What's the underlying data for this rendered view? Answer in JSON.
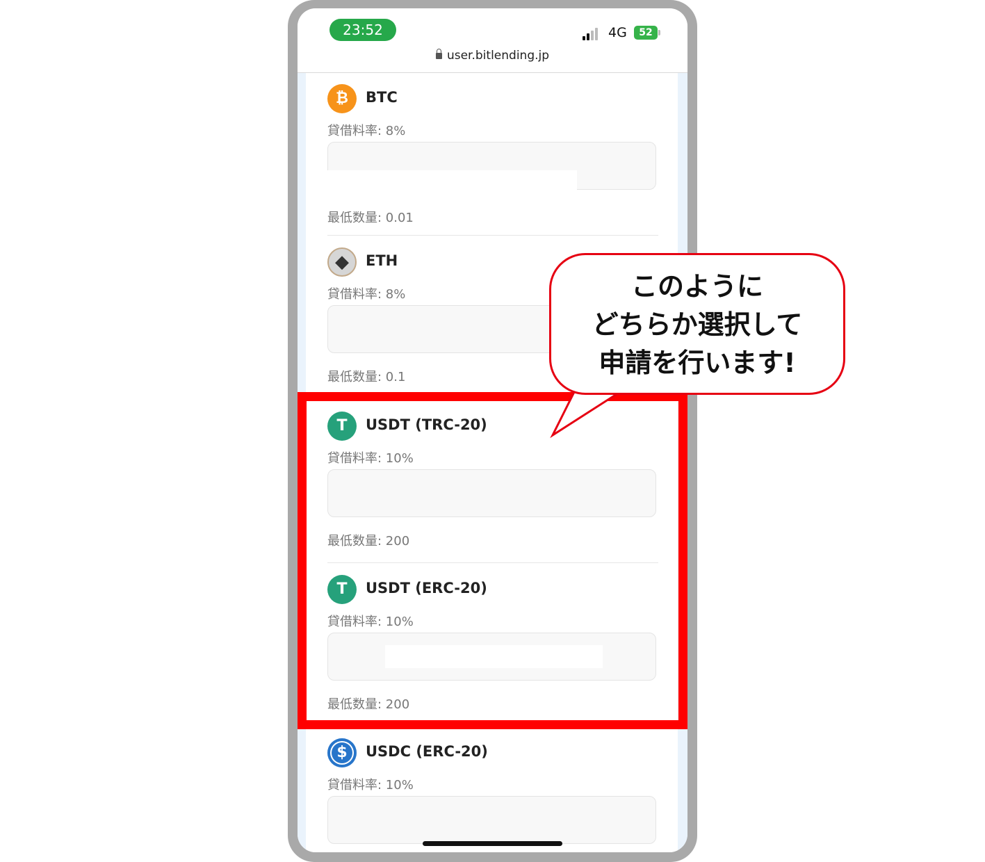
{
  "status_bar": {
    "time": "23:52",
    "network": "4G",
    "battery": "52"
  },
  "browser": {
    "url": "user.bitlending.jp"
  },
  "assets": [
    {
      "name": "BTC",
      "rate": "貸借料率: 8%",
      "min": "最低数量: 0.01",
      "icon": "bitcoin-icon",
      "symbol": "₿"
    },
    {
      "name": "ETH",
      "rate": "貸借料率: 8%",
      "min": "最低数量: 0.1",
      "icon": "ethereum-icon",
      "symbol": "◆"
    },
    {
      "name": "USDT (TRC-20)",
      "rate": "貸借料率: 10%",
      "min": "最低数量: 200",
      "icon": "tether-icon",
      "symbol": "T"
    },
    {
      "name": "USDT (ERC-20)",
      "rate": "貸借料率: 10%",
      "min": "最低数量: 200",
      "icon": "tether-icon",
      "symbol": "T"
    },
    {
      "name": "USDC (ERC-20)",
      "rate": "貸借料率: 10%",
      "icon": "usdc-icon",
      "symbol": "$"
    }
  ],
  "annotation": {
    "line1": "このように",
    "line2": "どちらか選択して",
    "line3": "申請を行います!",
    "color": "#e60012",
    "highlight_color": "#ff0000"
  }
}
